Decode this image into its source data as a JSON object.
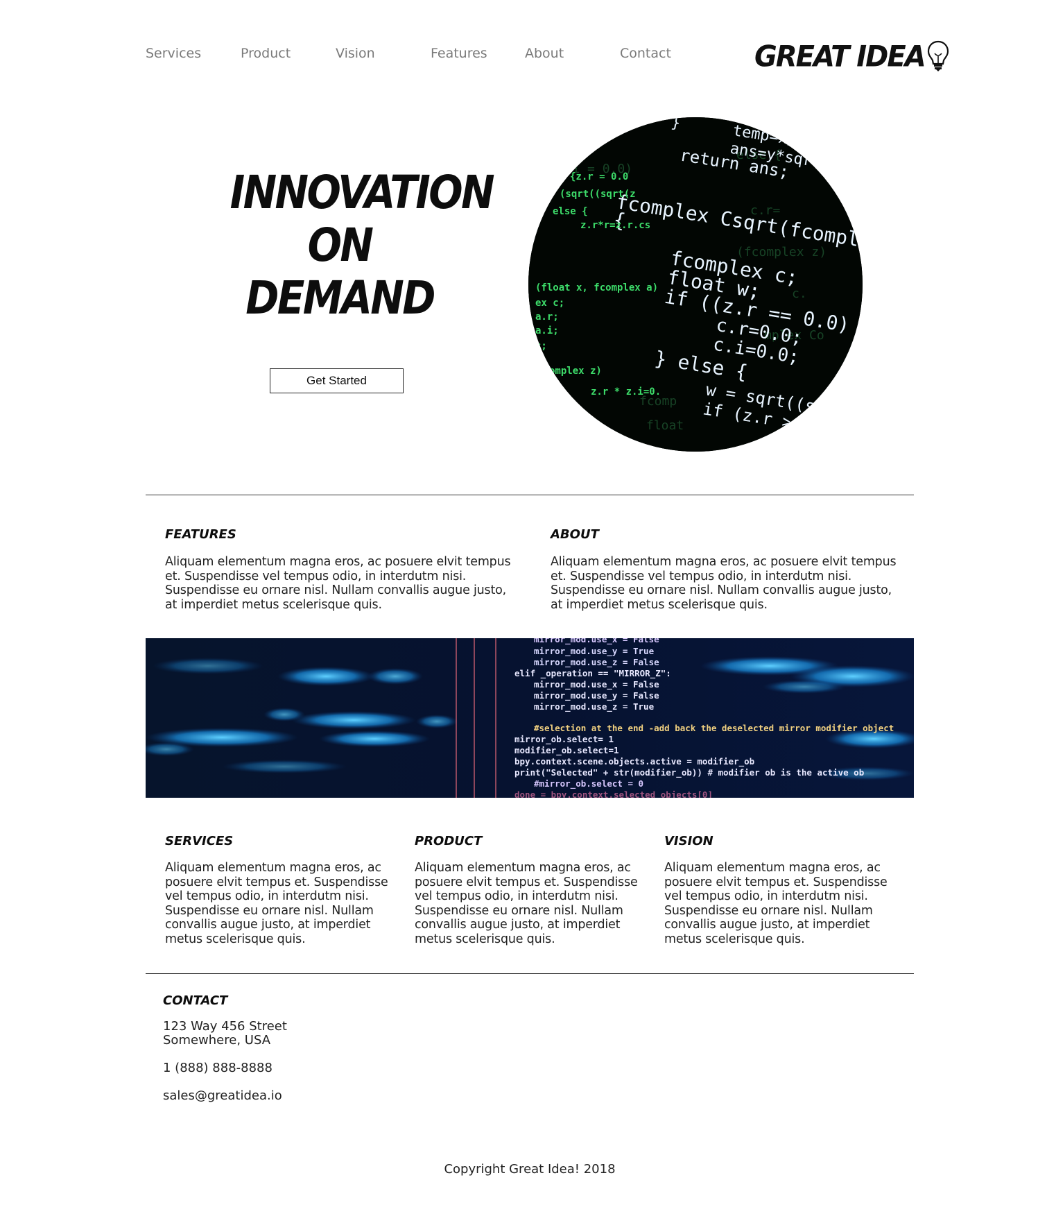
{
  "nav": {
    "items": [
      {
        "label": "Services"
      },
      {
        "label": "Product"
      },
      {
        "label": "Vision"
      },
      {
        "label": "Features"
      },
      {
        "label": "About"
      },
      {
        "label": "Contact"
      }
    ],
    "logo_text": "GREAT IDEA"
  },
  "hero": {
    "title_lines": [
      "INNOVATION",
      "ON",
      "DEMAND"
    ],
    "cta_label": "Get Started",
    "image_icon": "code-screen-image"
  },
  "sections_top": [
    {
      "heading": "FEATURES",
      "body_lines": [
        "Aliquam elementum magna eros, ac posuere elvit tempus",
        "et. Suspendisse vel tempus odio, in interdutm nisi.",
        "Suspendisse eu ornare nisl. Nullam convallis augue justo,",
        "at imperdiet metus scelerisque quis."
      ]
    },
    {
      "heading": "ABOUT",
      "body_lines": [
        "Aliquam elementum magna eros, ac posuere elvit tempus",
        "et. Suspendisse vel tempus odio, in interdutm nisi.",
        "Suspendisse eu ornare nisl. Nullam convallis augue justo,",
        "at imperdiet metus scelerisque quis."
      ]
    }
  ],
  "sections_bottom": [
    {
      "heading": "SERVICES",
      "body_lines": [
        "Aliquam elementum magna eros, ac",
        "posuere elvit tempus et. Suspendisse",
        "vel tempus odio, in interdutm nisi.",
        "Suspendisse eu ornare nisl. Nullam",
        "convallis augue justo, at imperdiet",
        "metus scelerisque quis."
      ]
    },
    {
      "heading": "PRODUCT",
      "body_lines": [
        "Aliquam elementum magna eros, ac",
        "posuere elvit tempus et. Suspendisse",
        "vel tempus odio, in interdutm nisi.",
        "Suspendisse eu ornare nisl. Nullam",
        "convallis augue justo, at imperdiet",
        "metus scelerisque quis."
      ]
    },
    {
      "heading": "VISION",
      "body_lines": [
        "Aliquam elementum magna eros, ac",
        "posuere elvit tempus et. Suspendisse",
        "vel tempus odio, in interdutm nisi.",
        "Suspendisse eu ornare nisl. Nullam",
        "convallis augue justo, at imperdiet",
        "metus scelerisque quis."
      ]
    }
  ],
  "contact": {
    "heading": "CONTACT",
    "address_line1": "123 Way 456 Street",
    "address_line2": "Somewhere, USA",
    "phone": "1 (888) 888-8888",
    "email": "sales@greatidea.io"
  },
  "footer": {
    "copyright": "Copyright Great Idea! 2018"
  },
  "colors": {
    "nav_text": "#7a7a7a",
    "heading": "#0d0d0d",
    "body_text": "#222222",
    "code_green": "#3ddc6a",
    "code_blue_glow": "#1aa7ff"
  }
}
